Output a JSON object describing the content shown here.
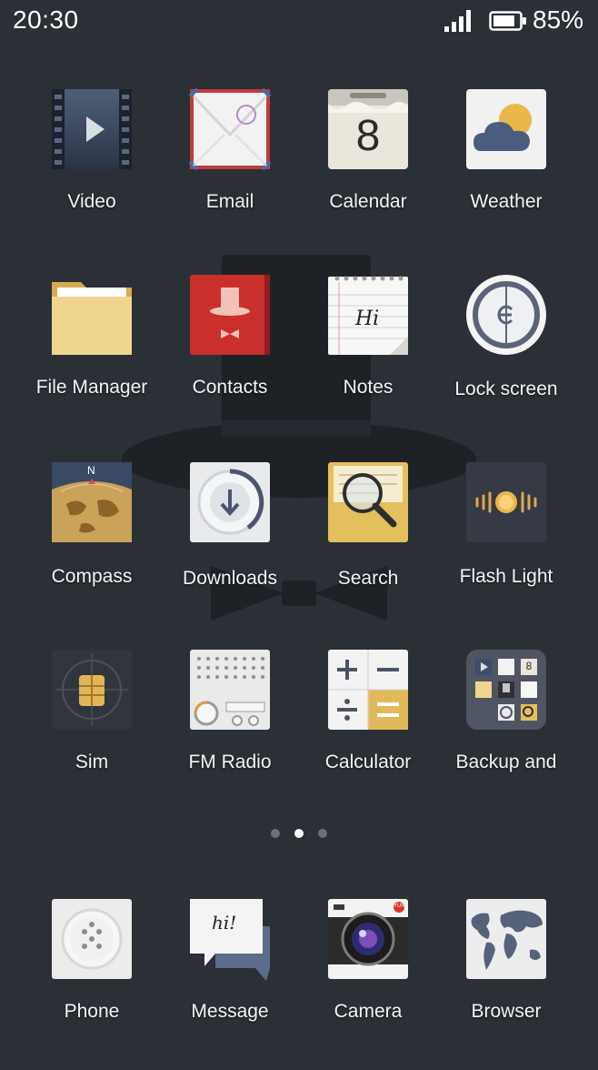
{
  "status_bar": {
    "time": "20:30",
    "battery_percent": "85%",
    "battery_level": 0.85,
    "signal_icon": "signal-bars-icon",
    "battery_icon": "battery-icon"
  },
  "home_rows": [
    [
      {
        "label": "Video",
        "icon": "video-icon"
      },
      {
        "label": "Email",
        "icon": "envelope-icon"
      },
      {
        "label": "Calendar",
        "icon": "calendar-icon",
        "detail": "8"
      },
      {
        "label": "Weather",
        "icon": "weather-icon"
      }
    ],
    [
      {
        "label": "File Manager",
        "icon": "folder-icon"
      },
      {
        "label": "Contacts",
        "icon": "contacts-icon"
      },
      {
        "label": "Notes",
        "icon": "notes-icon",
        "detail": "Hi"
      },
      {
        "label": "Lock screen",
        "icon": "lock-screen-icon"
      }
    ],
    [
      {
        "label": "Compass",
        "icon": "compass-icon",
        "detail": "N"
      },
      {
        "label": "Downloads",
        "icon": "download-icon"
      },
      {
        "label": "Search",
        "icon": "magnifier-icon"
      },
      {
        "label": "Flash Light",
        "icon": "flashlight-icon"
      }
    ],
    [
      {
        "label": "Sim",
        "icon": "sim-card-icon"
      },
      {
        "label": "FM Radio",
        "icon": "radio-icon"
      },
      {
        "label": "Calculator",
        "icon": "calculator-icon"
      },
      {
        "label": "Backup and",
        "icon": "backup-folder-icon",
        "detail": "8"
      }
    ]
  ],
  "page_indicator": {
    "pages": 3,
    "active_index": 1
  },
  "dock": [
    {
      "label": "Phone",
      "icon": "phone-dialpad-icon"
    },
    {
      "label": "Message",
      "icon": "message-bubble-icon",
      "detail": "hi!"
    },
    {
      "label": "Camera",
      "icon": "camera-icon",
      "detail": "YUN"
    },
    {
      "label": "Browser",
      "icon": "world-map-icon"
    }
  ],
  "colors": {
    "background": "#2b2f36",
    "accent_yellow": "#e8c468",
    "contacts_red": "#c9302c",
    "active_dot": "#ffffff",
    "inactive_dot": "#6c7079"
  }
}
